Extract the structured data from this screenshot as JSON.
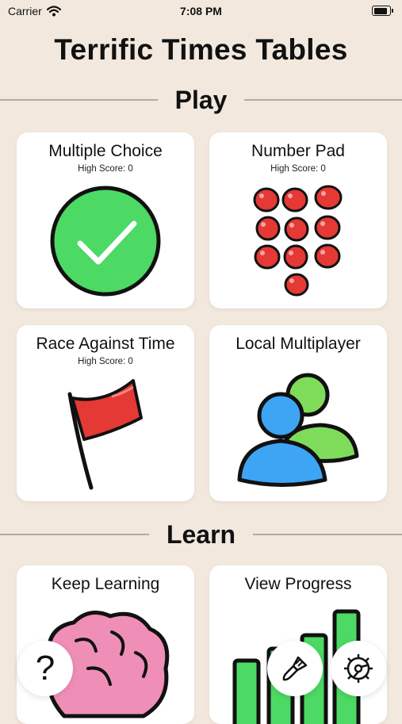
{
  "status": {
    "carrier": "Carrier",
    "time": "7:08 PM",
    "battery_level": 1.0
  },
  "app_title": "Terrific Times Tables",
  "sections": {
    "play": "Play",
    "learn": "Learn"
  },
  "play_cards": [
    {
      "title": "Multiple Choice",
      "high_score": "High Score: 0",
      "icon": "checkmark-circle-icon"
    },
    {
      "title": "Number Pad",
      "high_score": "High Score: 0",
      "icon": "number-pad-dots-icon"
    },
    {
      "title": "Race Against Time",
      "high_score": "High Score: 0",
      "icon": "red-flag-icon"
    },
    {
      "title": "Local Multiplayer",
      "icon": "two-people-icon"
    }
  ],
  "learn_cards": [
    {
      "title": "Keep Learning",
      "icon": "brain-icon"
    },
    {
      "title": "View Progress",
      "icon": "bar-chart-icon"
    }
  ],
  "floating_buttons": {
    "help": "?",
    "theme_icon": "paintbrush-icon",
    "settings_icon": "gear-icon"
  },
  "colors": {
    "background": "#f2e8de",
    "green": "#4cd964",
    "red": "#e53935",
    "blue": "#3da5f4",
    "light_green": "#7edc5a",
    "pink": "#ef8fb8"
  }
}
